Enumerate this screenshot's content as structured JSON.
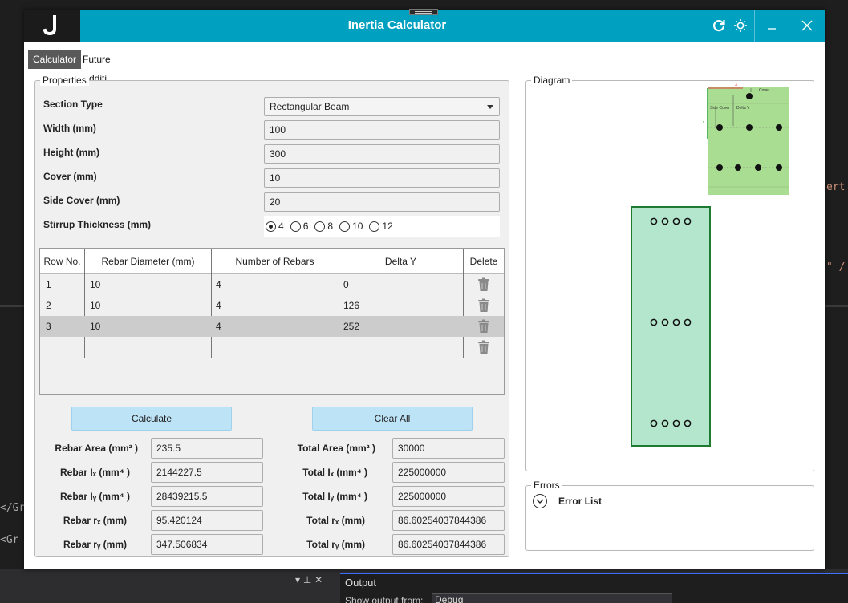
{
  "app": {
    "title": "Inertia Calculator",
    "logo": "J"
  },
  "tabs": [
    {
      "label": "Calculator",
      "active": true
    },
    {
      "label": "Future Additi",
      "active": false
    }
  ],
  "properties": {
    "group_title": "Properties",
    "section_type": {
      "label": "Section Type",
      "value": "Rectangular Beam"
    },
    "width": {
      "label": "Width (mm)",
      "value": "100"
    },
    "height": {
      "label": "Height (mm)",
      "value": "300"
    },
    "cover": {
      "label": "Cover (mm)",
      "value": "10"
    },
    "side_cover": {
      "label": "Side Cover (mm)",
      "value": "20"
    },
    "stirrup": {
      "label": "Stirrup Thickness (mm)",
      "options": [
        "4",
        "6",
        "8",
        "10",
        "12"
      ],
      "selected": "4"
    }
  },
  "table": {
    "headers": {
      "row_no": "Row No.",
      "rebar_diameter": "Rebar Diameter (mm)",
      "number_of_rebars": "Number of Rebars",
      "delta_y": "Delta Y",
      "delete": "Delete"
    },
    "rows": [
      {
        "row_no": "1",
        "diameter": "10",
        "count": "4",
        "delta_y": "0"
      },
      {
        "row_no": "2",
        "diameter": "10",
        "count": "4",
        "delta_y": "126"
      },
      {
        "row_no": "3",
        "diameter": "10",
        "count": "4",
        "delta_y": "252"
      },
      {
        "row_no": "",
        "diameter": "",
        "count": "",
        "delta_y": ""
      }
    ]
  },
  "buttons": {
    "calculate": "Calculate",
    "clear_all": "Clear All"
  },
  "results": {
    "rebar_area": {
      "label": "Rebar Area (mm² )",
      "value": "235.5"
    },
    "rebar_ix": {
      "label": "Rebar Iₓ (mm⁴ )",
      "value": "2144227.5"
    },
    "rebar_iy": {
      "label": "Rebar Iᵧ (mm⁴ )",
      "value": "28439215.5"
    },
    "rebar_rx": {
      "label": "Rebar rₓ (mm)",
      "value": "95.420124"
    },
    "rebar_ry": {
      "label": "Rebar rᵧ (mm)",
      "value": "347.506834"
    },
    "total_area": {
      "label": "Total Area (mm² )",
      "value": "30000"
    },
    "total_ix": {
      "label": "Total Iₓ (mm⁴ )",
      "value": "225000000"
    },
    "total_iy": {
      "label": "Total Iᵧ (mm⁴ )",
      "value": "225000000"
    },
    "total_rx": {
      "label": "Total rₓ (mm)",
      "value": "86.60254037844386"
    },
    "total_ry": {
      "label": "Total rᵧ (mm)",
      "value": "86.60254037844386"
    }
  },
  "diagram": {
    "group_title": "Diagram",
    "ref_labels": {
      "x": "X",
      "y": "Y",
      "cover": "Cover",
      "side_cover": "Side Cover",
      "delta_y": "Delta Y"
    },
    "section_fill": "#b3e6cc",
    "section_stroke": "#1d7a2f"
  },
  "errors": {
    "group_title": "Errors",
    "list_label": "Error List"
  },
  "ide": {
    "left_text_1": "</Gr",
    "left_text_2": "<Gr",
    "right_text_1": "ert",
    "right_text_2": "\" /",
    "output_title": "Output",
    "show_output_label": "Show output from:",
    "show_output_value": "Debug"
  },
  "colors": {
    "titlebar": "#00a0c0",
    "button": "#bde3f7",
    "active_tab": "#595959"
  }
}
